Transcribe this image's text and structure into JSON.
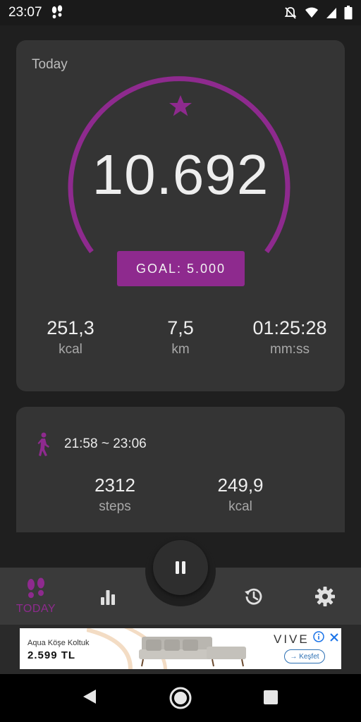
{
  "status_bar": {
    "time": "23:07"
  },
  "today_card": {
    "label": "Today",
    "steps": "10.692",
    "goal_label": "GOAL: 5.000",
    "stats": [
      {
        "value": "251,3",
        "unit": "kcal"
      },
      {
        "value": "7,5",
        "unit": "km"
      },
      {
        "value": "01:25:28",
        "unit": "mm:ss"
      }
    ]
  },
  "session_card": {
    "time_range": "21:58 ~ 23:06",
    "stats": [
      {
        "value": "2312",
        "unit": "steps"
      },
      {
        "value": "249,9",
        "unit": "kcal"
      }
    ]
  },
  "bottom_nav": {
    "items": [
      {
        "label": "TODAY",
        "icon": "footsteps-icon",
        "active": true
      },
      {
        "label": "",
        "icon": "bar-chart-icon"
      },
      {
        "label": "",
        "icon": "history-icon"
      },
      {
        "label": "",
        "icon": "gear-icon"
      }
    ],
    "center_icon": "pause-icon"
  },
  "ad": {
    "title": "Aqua Köşe Koltuk",
    "price": "2.599 TL",
    "brand": "VIVE",
    "cta": "→ Keşfet"
  },
  "colors": {
    "accent": "#8e2a8e",
    "card_bg": "#343434",
    "page_bg": "#1f1f1f"
  }
}
